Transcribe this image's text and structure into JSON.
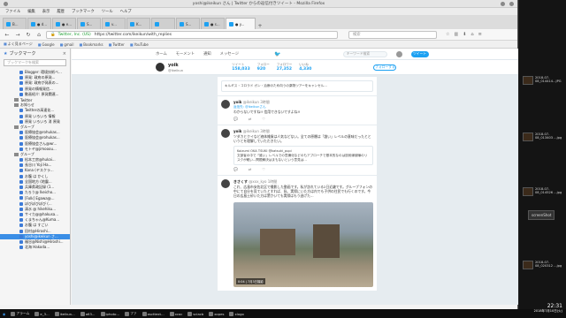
{
  "window": {
    "title": "yoshi@ikeikun さん | Twitter からの返信付きツイート - Mozilla Firefox",
    "menu": [
      "ファイル",
      "編集",
      "表示",
      "履歴",
      "ブックマーク",
      "ツール",
      "ヘルプ"
    ]
  },
  "tabs": [
    "B...",
    "● d...",
    "● e...",
    "S...",
    "v...",
    "K...",
    "",
    "S...",
    "● s...",
    "● y..."
  ],
  "address": {
    "url": "https://twitter.com/ikeikun/with_replies",
    "identity": "Twitter, Inc. (US)"
  },
  "search_placeholder": "検索",
  "bookmarks_toolbar": [
    "よく見るページ",
    "Google",
    "gmail",
    "Bookmarks",
    "Twitter",
    "YouTube"
  ],
  "sidebar": {
    "title": "ブックマーク",
    "search_placeholder": "ブックマークを検索",
    "items": [
      {
        "label": "Blogger: 環境技術ベ...",
        "type": "link"
      },
      {
        "label": "原発: 政府の原発...",
        "type": "link"
      },
      {
        "label": "原発: 政府が発表の...",
        "type": "link"
      },
      {
        "label": "原発の情報発信...",
        "type": "link"
      },
      {
        "label": "動画紹介: 原発関連...",
        "type": "link"
      },
      {
        "label": "Twitter",
        "type": "folder"
      },
      {
        "label": "お知らせ",
        "type": "folder"
      },
      {
        "label": "Twitterの高速化...",
        "type": "link"
      },
      {
        "label": "原発 いろいろ 情報",
        "type": "link"
      },
      {
        "label": "原発 いろいろ 消 原発",
        "type": "link"
      },
      {
        "label": "グループ",
        "type": "folder"
      },
      {
        "label": "医療協会@rohukas...",
        "type": "link"
      },
      {
        "label": "医療協会@rohukas...",
        "type": "link"
      },
      {
        "label": "医療協会さん@wr...",
        "type": "link"
      },
      {
        "label": "モトヤ@jimooou...",
        "type": "link"
      },
      {
        "label": "グループ",
        "type": "folder"
      },
      {
        "label": "松本工房@hukai...",
        "type": "link"
      },
      {
        "label": "長谷川 Yoji Ha...",
        "type": "link"
      },
      {
        "label": "Kana (ヤスクラ...",
        "type": "link"
      },
      {
        "label": "お腹 は かくし",
        "type": "link"
      },
      {
        "label": "全国地方 (地震...",
        "type": "link"
      },
      {
        "label": "兵庫県政記録 (1...",
        "type": "link"
      },
      {
        "label": "たろう@ Ikeicho...",
        "type": "link"
      },
      {
        "label": "[Folk] Egawa@...",
        "type": "link"
      },
      {
        "label": "ぼびぼびぼび (...",
        "type": "link"
      },
      {
        "label": "清水 @ hikehiku...",
        "type": "link"
      },
      {
        "label": "サイカ@@hakusa...",
        "type": "link"
      },
      {
        "label": "くまちゃん@Kuma...",
        "type": "link"
      },
      {
        "label": "お腹 は すごい",
        "type": "link"
      },
      {
        "label": "田村@Hiroshi...",
        "type": "link"
      },
      {
        "label": "yoshi@ikeikun さ...",
        "type": "link",
        "selected": true
      },
      {
        "label": "福谷@Nishi@Hiroshi...",
        "type": "link"
      },
      {
        "label": "北海 Hakoda...",
        "type": "link"
      }
    ]
  },
  "twitter": {
    "nav": [
      "ホーム",
      "モーメント",
      "通知",
      "メッセージ"
    ],
    "search_placeholder": "キーワード検索",
    "tweet_button": "ツイート",
    "profile": {
      "name": "yoik",
      "handle": "@ikeikun",
      "stats": [
        {
          "label": "ツイート",
          "value": "158,033"
        },
        {
          "label": "フォロー",
          "value": "920"
        },
        {
          "label": "フォロワー",
          "value": "27,352"
        },
        {
          "label": "いいね",
          "value": "4,330"
        }
      ],
      "follow_button": "フォローする"
    },
    "tweets": [
      {
        "name": "",
        "handle": "",
        "text": "キルギス・コロラド ガン・治療のため向うの薬物ツアーをキャンセル...",
        "quote": ""
      },
      {
        "name": "yoik",
        "handle": "@ikeikun 3時間",
        "reply_to": "返信先: @ikeikunさん",
        "text": "わからないですね!! 信用できないですよね!!",
        "quote": ""
      },
      {
        "name": "yoik",
        "handle": "@ikeikun 3時間",
        "reply_to": "",
        "text": "ツダカとクイなど液体雑貨は人気などない。全ての原爆は「誰い」レベルの意味だったとというとを理解していただきたい。",
        "quote": "Koizumi OKA TSUKI @katsuki_pupi\n文部省の中で「誰い」レベルでの意識化などのもアプローチで基本的なのは放射線被曝のリスクが軽い...問題解決はまもないという意見は..."
      },
      {
        "name": "きさくす",
        "handle": "@xxx_kyo 1時間",
        "reply_to": "",
        "text": "これ、広島市安佐北区で撮影した動画です。私が訪れている2日近畿です。グループフォンの中にて自分を見ていたとすれば、私、実際にいた方は内でも子供の住民でも行くのです。今日の広島土砂いた方は驚かいても実際はもう逃げた...",
        "photo_caption": "0:04 | 7月3日撮影",
        "quote": ""
      }
    ]
  },
  "right_panel": {
    "files": [
      {
        "name": "2018-07-08_014414...JPG"
      },
      {
        "name": "2018-07-08_013403 ...jpg"
      },
      {
        "name": "2018-07-08_014526 ...jpg"
      },
      {
        "name": "2018-07-08_020312 ...jpg"
      }
    ],
    "screenshot_label": "screenShot"
  },
  "taskbar": {
    "items": [
      "アラーム",
      "e_3...",
      "ikeikun...",
      "a63...",
      "iphoto...",
      "ファ",
      "ascttext...",
      "xcoc",
      "sciacb",
      "xopes",
      "xlogo"
    ],
    "time": "22:31",
    "date": "2018年7月10日(火)"
  }
}
